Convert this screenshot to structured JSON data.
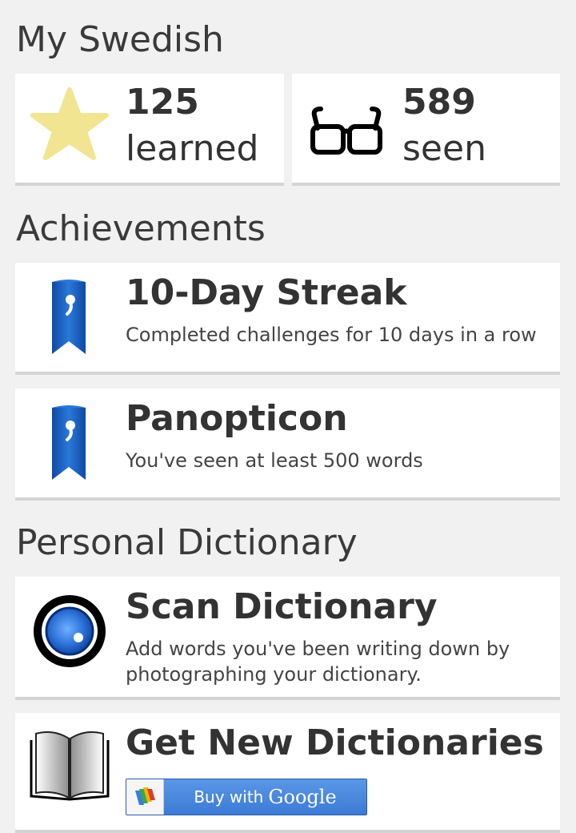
{
  "my_swedish": {
    "title": "My Swedish",
    "learned": {
      "count": "125",
      "label": "learned",
      "icon": "star-icon"
    },
    "seen": {
      "count": "589",
      "label": "seen",
      "icon": "glasses-icon"
    }
  },
  "achievements": {
    "title": "Achievements",
    "items": [
      {
        "title": "10-Day Streak",
        "description": "Completed challenges for 10 days in a row",
        "icon": "ribbon-icon"
      },
      {
        "title": "Panopticon",
        "description": "You've seen at least 500 words",
        "icon": "ribbon-icon"
      }
    ]
  },
  "personal_dictionary": {
    "title": "Personal Dictionary",
    "scan": {
      "title": "Scan Dictionary",
      "description": "Add words you've been writing down by photographing your dictionary.",
      "icon": "camera-lens-icon"
    },
    "get_new": {
      "title": "Get New Dictionaries",
      "icon": "book-icon",
      "buy_button": {
        "prefix": "Buy with",
        "brand": "Google"
      }
    }
  },
  "colors": {
    "star": "#f1e592",
    "ribbon": "#1b5fbf",
    "lens": "#2a6fd6",
    "button_blue": "#4a88e0"
  }
}
